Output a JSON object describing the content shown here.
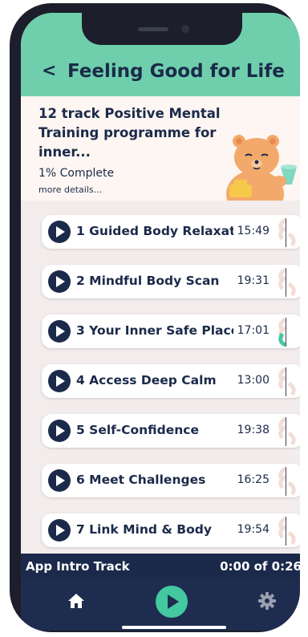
{
  "header": {
    "back_icon": "chevron-left-icon",
    "title": "Feeling Good for Life",
    "background": "#6fcfac"
  },
  "intro": {
    "description": "12 track Positive Mental Training programme for inner...",
    "progress_text": "1% Complete",
    "more_details": "more details..."
  },
  "tracks": [
    {
      "name": "1 Guided Body Relaxat",
      "duration": "15:49"
    },
    {
      "name": "2 Mindful Body Scan",
      "duration": "19:31"
    },
    {
      "name": "3 Your Inner Safe Place",
      "duration": "17:01"
    },
    {
      "name": "4 Access Deep Calm",
      "duration": "13:00"
    },
    {
      "name": "5 Self-Confidence",
      "duration": "19:38"
    },
    {
      "name": "6 Meet Challenges",
      "duration": "16:25"
    },
    {
      "name": "7 Link Mind & Body",
      "duration": "19:54"
    }
  ],
  "now_playing": {
    "title": "App Intro Track",
    "time": "0:00 of 0:26"
  },
  "tabbar": {
    "items": [
      {
        "icon": "home-icon"
      },
      {
        "icon": "play-icon"
      },
      {
        "icon": "gear-icon"
      }
    ]
  },
  "colors": {
    "accent": "#6fcfac",
    "navy": "#1b2a4a",
    "play_green": "#43c8a0"
  }
}
